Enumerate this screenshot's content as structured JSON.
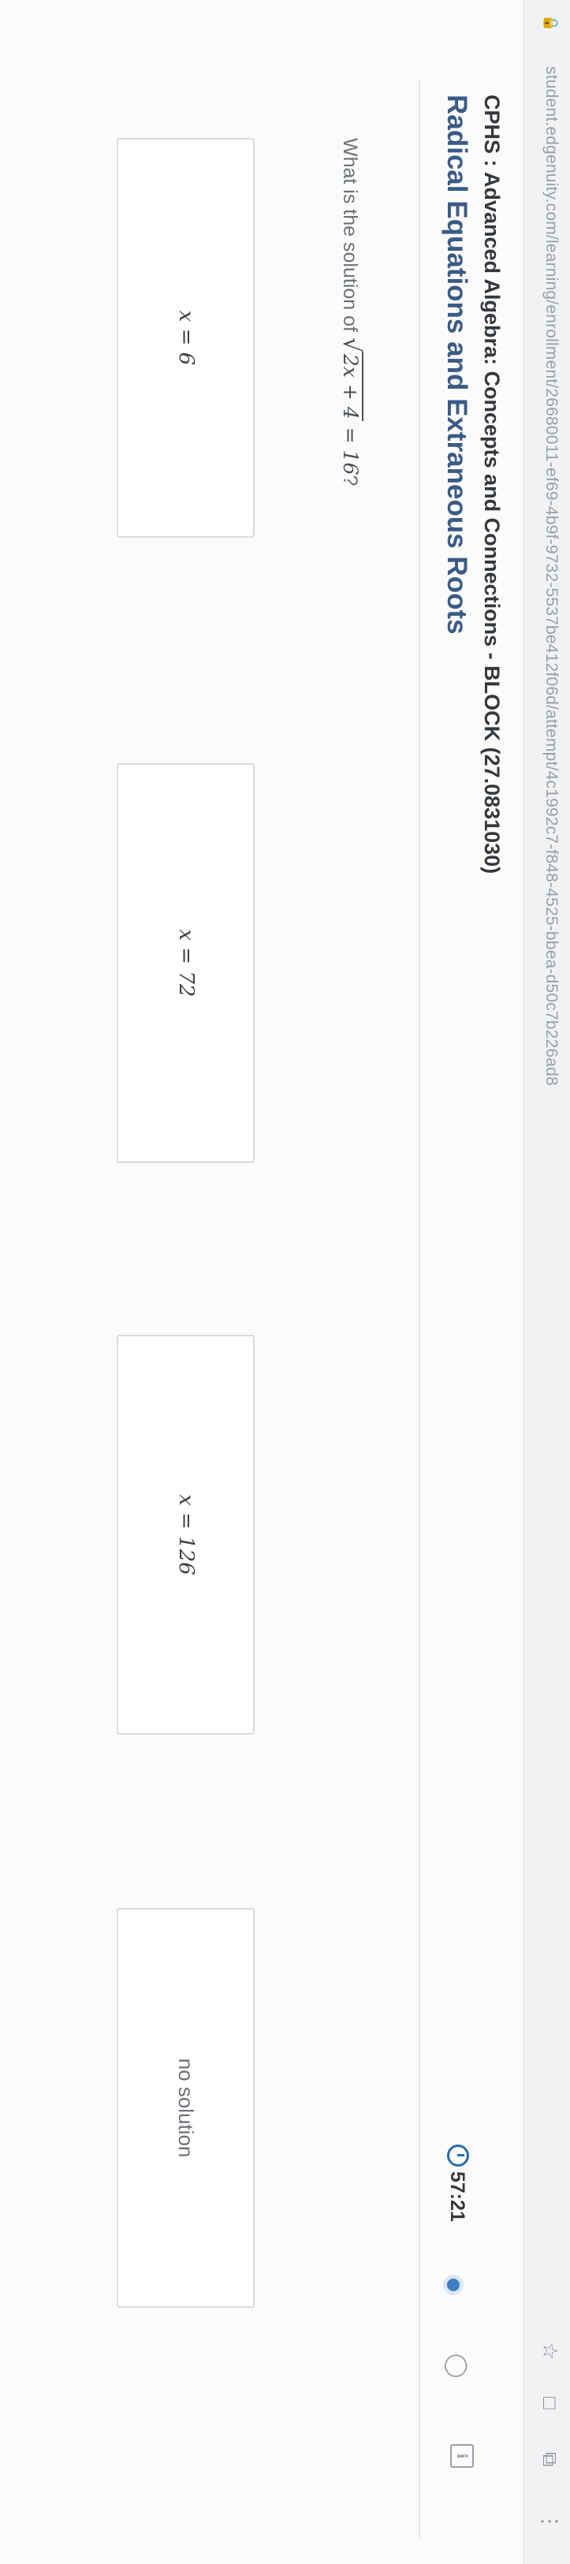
{
  "browser": {
    "url": "student.edgenuity.com/learning/enrollment/26680011-ef69-4b9f-9732-5537be412f06d/attempt/4c1992c7-f848-4525-bbea-d50c7b226ad8",
    "icons": [
      "lock-icon",
      "star-icon",
      "extension-icon",
      "tab-icon",
      "menu-icon"
    ]
  },
  "header": {
    "course_title": "CPHS : Advanced Algebra: Concepts and Connections - BLOCK (27.0831030)",
    "lesson_title": "Radical Equations and Extraneous Roots",
    "timer": "57:21"
  },
  "question": {
    "prefix": "What is the solution of ",
    "radical": "2x + 4",
    "suffix_math": " = 16",
    "suffix": "?"
  },
  "choices": [
    {
      "label": "x = 6"
    },
    {
      "label": "x = 72"
    },
    {
      "label": "x = 126"
    },
    {
      "label": "no solution"
    }
  ],
  "colors": {
    "lesson_title": "#3a5b87",
    "accent": "#2b6cb0",
    "choice_border": "#d9dbde"
  }
}
